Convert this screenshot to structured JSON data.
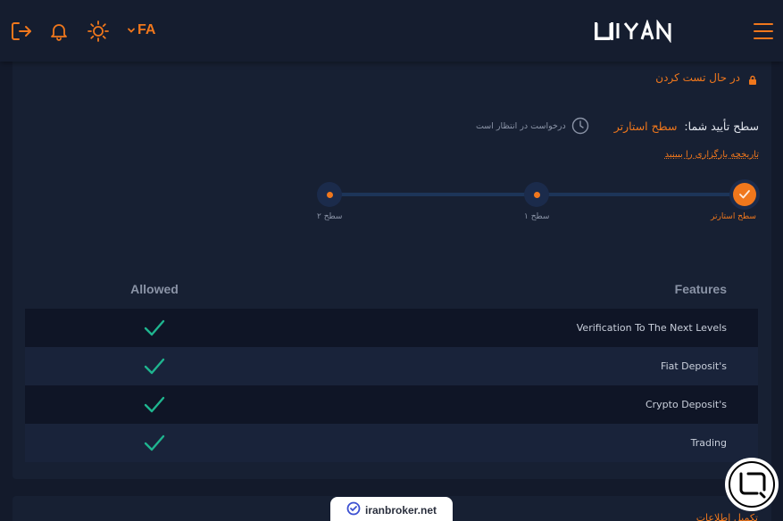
{
  "header": {
    "language": "FA",
    "logo_text": "LIYAN",
    "icons": [
      "logout-icon",
      "bell-icon",
      "sun-icon",
      "chevron-down-icon",
      "hamburger-icon"
    ]
  },
  "level": {
    "status_text": "در حال تست کردن",
    "verify_label": "سطح تأیید شما:",
    "verify_value": "سطح استارتر",
    "pending_text": "درخواست در انتظار است",
    "history_link": "تاریخچه بارگزاری را ببینید",
    "steps": [
      {
        "label": "سطح استارتر",
        "done": true
      },
      {
        "label": "سطح ۱",
        "done": false
      },
      {
        "label": "سطح ۲",
        "done": false
      }
    ]
  },
  "table": {
    "headers": {
      "features": "Features",
      "allowed": "Allowed"
    },
    "rows": [
      {
        "feature": "Verification To The Next Levels",
        "allowed": true
      },
      {
        "feature": "Fiat Deposit's",
        "allowed": true
      },
      {
        "feature": "Crypto Deposit's",
        "allowed": true
      },
      {
        "feature": "Trading",
        "allowed": true
      }
    ]
  },
  "bottom": {
    "card_text": "تکمیل اطلاعات",
    "watermark": "iranbroker.net"
  },
  "colors": {
    "accent": "#f0771c",
    "check": "#1fb58f",
    "background": "#131a2b"
  }
}
